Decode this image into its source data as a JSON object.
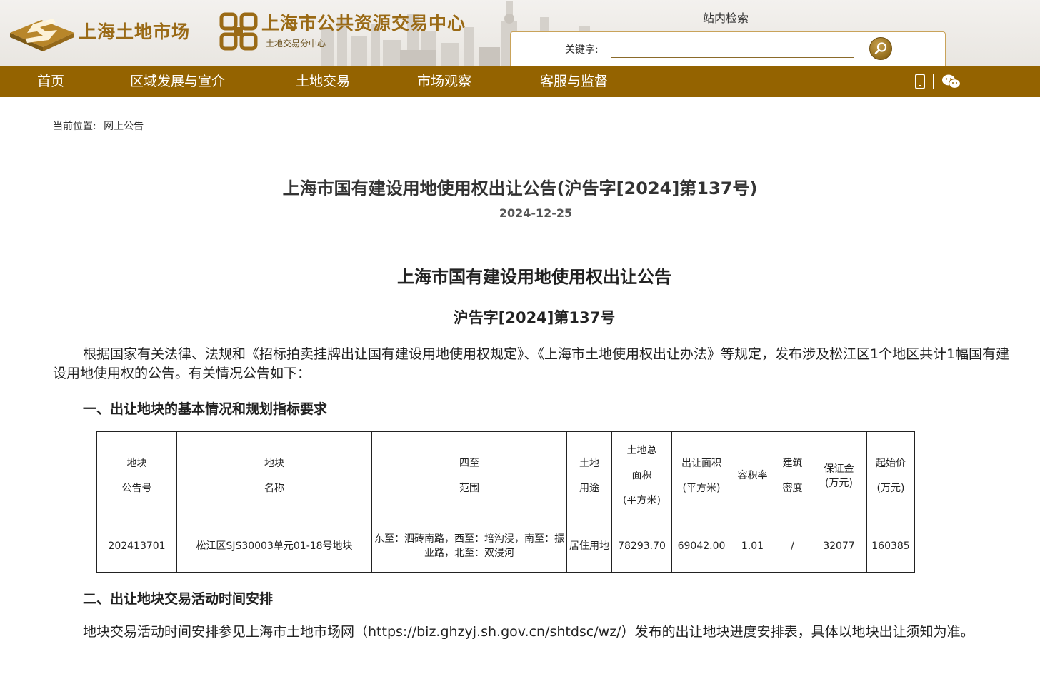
{
  "header": {
    "logo1_text": "上海土地市场",
    "logo2_title": "上海市公共资源交易中心",
    "logo2_subtitle": "土地交易分中心",
    "search_title": "站内检索",
    "search_label": "关键字:",
    "search_value": ""
  },
  "nav": {
    "items": [
      {
        "label": "首页"
      },
      {
        "label": "区域发展与宣介"
      },
      {
        "label": "土地交易"
      },
      {
        "label": "市场观察"
      },
      {
        "label": "客服与监督"
      }
    ],
    "icons": [
      "mobile-icon",
      "wechat-icon"
    ]
  },
  "breadcrumb": {
    "prefix": "当前位置:",
    "current": "网上公告"
  },
  "page": {
    "title": "上海市国有建设用地使用权出让公告(沪告字[2024]第137号)",
    "date": "2024-12-25"
  },
  "document": {
    "title": "上海市国有建设用地使用权出让公告",
    "number": "沪告字[2024]第137号",
    "intro": "根据国家有关法律、法规和《招标拍卖挂牌出让国有建设用地使用权规定》、《上海市土地使用权出让办法》等规定，发布涉及松江区1个地区共计1幅国有建设用地使用权的公告。有关情况公告如下：",
    "section1": "一、出让地块的基本情况和规划指标要求",
    "section2": "二、出让地块交易活动时间安排",
    "schedule": "地块交易活动时间安排参见上海市土地市场网（https://biz.ghzyj.sh.gov.cn/shtdsc/wz/）发布的出让地块进度安排表，具体以地块出让须知为准。"
  },
  "table": {
    "headers": [
      [
        "地块",
        "公告号"
      ],
      [
        "地块",
        "名称"
      ],
      [
        "四至",
        "范围"
      ],
      [
        "土地",
        "用途"
      ],
      [
        "土地总",
        "面积",
        "(平方米)"
      ],
      [
        "出让面积",
        "(平方米)"
      ],
      [
        "容积率"
      ],
      [
        "建筑",
        "密度"
      ],
      [
        "保证金",
        "(万元)"
      ],
      [
        "起始价",
        "(万元)"
      ]
    ],
    "rows": [
      [
        "202413701",
        "松江区SJS30003单元01-18号地块",
        "东至：泗砖南路，西至：培沟浸，南至：振业路，北至：双浸河",
        "居住用地",
        "78293.70",
        "69042.00",
        "1.01",
        "/",
        "32077",
        "160385"
      ]
    ]
  },
  "colors": {
    "brand_gold": "#946300",
    "logo_gold": "#9a6a16"
  }
}
